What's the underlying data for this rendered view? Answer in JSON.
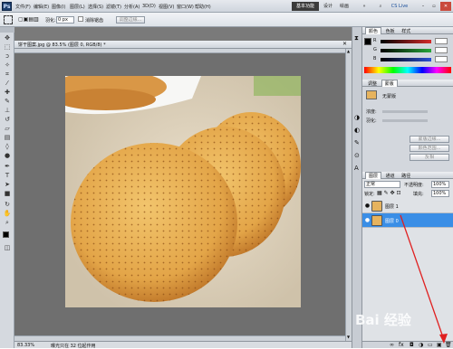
{
  "menubar": {
    "logo": "Ps",
    "items": [
      "文件(F)",
      "编辑(E)",
      "图像(I)",
      "图层(L)",
      "选择(S)",
      "滤镜(T)",
      "分析(A)",
      "3D(D)",
      "视图(V)",
      "窗口(W)",
      "帮助(H)"
    ],
    "zoom": "83.5",
    "workspaces": [
      "基本功能",
      "设计",
      "绘画"
    ],
    "cslive": "CS Live"
  },
  "options": {
    "feather_label": "羽化:",
    "feather_value": "0 px",
    "antialias_label": "消除锯齿",
    "style_label": "样式:",
    "refine_edge": "调整边缘..."
  },
  "document": {
    "tab_title": "饼干图案.jpg @ 83.5% (图层 0, RGB/8) *",
    "zoom_status": "83.33%",
    "status_text": "曝光只在 32 位起作用"
  },
  "color_panel": {
    "tabs": [
      "颜色",
      "色板",
      "样式"
    ],
    "channels": [
      "R",
      "G",
      "B"
    ]
  },
  "adjust_panel": {
    "tabs": [
      "调整",
      "蒙版"
    ],
    "title": "无蒙版",
    "fields": [
      "浓度:",
      "羽化:"
    ],
    "buttons": [
      "蒙版边缘...",
      "颜色范围...",
      "反相"
    ]
  },
  "layers_panel": {
    "tabs": [
      "图层",
      "通道",
      "路径"
    ],
    "blend_mode": "正常",
    "opacity_label": "不透明度:",
    "opacity_value": "100%",
    "lock_label": "锁定:",
    "fill_label": "填充:",
    "fill_value": "100%",
    "layers": [
      {
        "name": "图层 1",
        "selected": false
      },
      {
        "name": "图层 0",
        "selected": true
      }
    ]
  },
  "watermark": "Bai 经验",
  "colors": {
    "accent": "#3a8ee6",
    "arrow": "#e02020",
    "r_bar": "#d42a2a",
    "g_bar": "#27a83a",
    "b_bar": "#2a4fd4"
  },
  "icons": [
    "move-icon",
    "marquee-icon",
    "lasso-icon",
    "magic-wand-icon",
    "crop-icon",
    "eyedropper-icon",
    "healing-icon",
    "brush-icon",
    "stamp-icon",
    "history-brush-icon",
    "eraser-icon",
    "gradient-icon",
    "blur-icon",
    "dodge-icon",
    "pen-icon",
    "type-icon",
    "path-select-icon",
    "shape-icon",
    "hand-icon",
    "zoom-icon"
  ]
}
